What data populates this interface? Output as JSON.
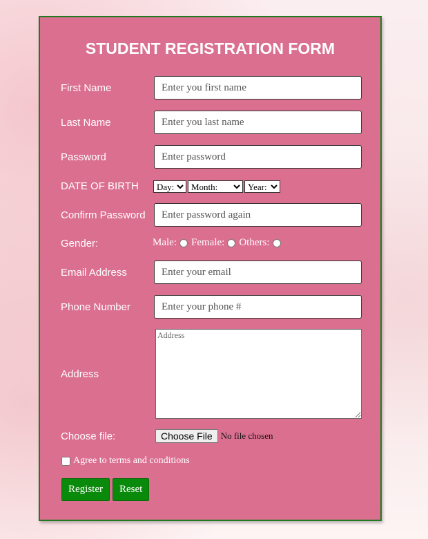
{
  "form": {
    "title": "STUDENT REGISTRATION FORM",
    "first_name": {
      "label": "First Name",
      "placeholder": "Enter you first name",
      "value": ""
    },
    "last_name": {
      "label": "Last Name",
      "placeholder": "Enter you last name",
      "value": ""
    },
    "password": {
      "label": "Password",
      "placeholder": "Enter password",
      "value": ""
    },
    "dob": {
      "label": "DATE OF BIRTH",
      "day": "Day:",
      "month": "Month:",
      "year": "Year:"
    },
    "confirm_password": {
      "label": "Confirm Password",
      "placeholder": "Enter password again",
      "value": ""
    },
    "gender": {
      "label": "Gender:",
      "options": [
        "Male:",
        "Female:",
        "Others:"
      ]
    },
    "email": {
      "label": "Email Address",
      "placeholder": "Enter your email",
      "value": ""
    },
    "phone": {
      "label": "Phone Number",
      "placeholder": "Enter your phone #",
      "value": ""
    },
    "address": {
      "label": "Address",
      "placeholder": "Address",
      "value": ""
    },
    "file": {
      "label": "Choose file:",
      "button": "Choose File",
      "status": "No file chosen"
    },
    "terms": {
      "label": "Agree to terms and conditions",
      "checked": false
    },
    "buttons": {
      "register": "Register",
      "reset": "Reset"
    }
  },
  "colors": {
    "card_bg": "#db6f8f",
    "card_border": "#1f7a1f",
    "button_bg": "#0a8a0a"
  }
}
